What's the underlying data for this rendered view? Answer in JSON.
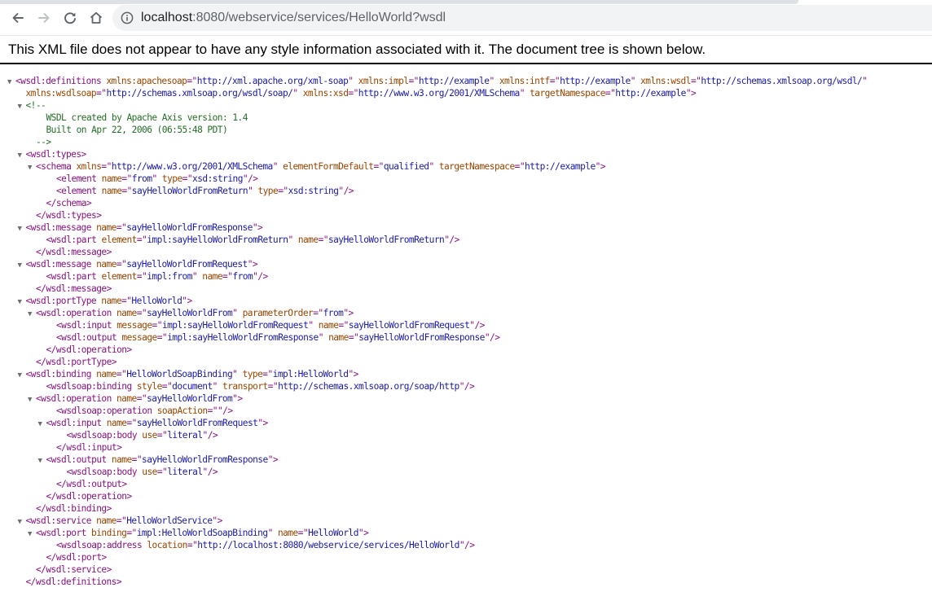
{
  "browser": {
    "url_host": "localhost",
    "url_rest": ":8080/webservice/services/HelloWorld?wsdl"
  },
  "notice": "This XML file does not appear to have any style information associated with it. The document tree is shown below.",
  "colors": {
    "tag": "#881280",
    "attr_name": "#994500",
    "attr_value": "#1a1aa6",
    "comment": "#236e25"
  },
  "lines": [
    {
      "indent": 0,
      "arrow": true,
      "parts": [
        [
          "tg",
          "<wsdl:definitions "
        ],
        [
          "an",
          "xmlns:apachesoap"
        ],
        [
          "tg",
          "=\""
        ],
        [
          "av",
          "http://xml.apache.org/xml-soap"
        ],
        [
          "tg",
          "\" "
        ],
        [
          "an",
          "xmlns:impl"
        ],
        [
          "tg",
          "=\""
        ],
        [
          "av",
          "http://example"
        ],
        [
          "tg",
          "\" "
        ],
        [
          "an",
          "xmlns:intf"
        ],
        [
          "tg",
          "=\""
        ],
        [
          "av",
          "http://example"
        ],
        [
          "tg",
          "\" "
        ],
        [
          "an",
          "xmlns:wsdl"
        ],
        [
          "tg",
          "=\""
        ],
        [
          "av",
          "http://schemas.xmlsoap.org/wsdl/"
        ],
        [
          "tg",
          "\""
        ]
      ]
    },
    {
      "indent": 1,
      "arrow": false,
      "parts": [
        [
          "an",
          "xmlns:wsdlsoap"
        ],
        [
          "tg",
          "=\""
        ],
        [
          "av",
          "http://schemas.xmlsoap.org/wsdl/soap/"
        ],
        [
          "tg",
          "\" "
        ],
        [
          "an",
          "xmlns:xsd"
        ],
        [
          "tg",
          "=\""
        ],
        [
          "av",
          "http://www.w3.org/2001/XMLSchema"
        ],
        [
          "tg",
          "\" "
        ],
        [
          "an",
          "targetNamespace"
        ],
        [
          "tg",
          "=\""
        ],
        [
          "av",
          "http://example"
        ],
        [
          "tg",
          "\">"
        ]
      ]
    },
    {
      "indent": 1,
      "arrow": true,
      "parts": [
        [
          "cm",
          "<!--"
        ]
      ]
    },
    {
      "indent": 3,
      "arrow": false,
      "parts": [
        [
          "cm",
          "WSDL created by Apache Axis version: 1.4"
        ]
      ]
    },
    {
      "indent": 3,
      "arrow": false,
      "parts": [
        [
          "cm",
          "Built on Apr 22, 2006 (06:55:48 PDT)"
        ]
      ]
    },
    {
      "indent": 2,
      "arrow": false,
      "parts": [
        [
          "cm",
          "-->"
        ]
      ]
    },
    {
      "indent": 1,
      "arrow": true,
      "parts": [
        [
          "tg",
          "<wsdl:types>"
        ]
      ]
    },
    {
      "indent": 2,
      "arrow": true,
      "parts": [
        [
          "tg",
          "<schema "
        ],
        [
          "an",
          "xmlns"
        ],
        [
          "tg",
          "=\""
        ],
        [
          "av",
          "http://www.w3.org/2001/XMLSchema"
        ],
        [
          "tg",
          "\" "
        ],
        [
          "an",
          "elementFormDefault"
        ],
        [
          "tg",
          "=\""
        ],
        [
          "av",
          "qualified"
        ],
        [
          "tg",
          "\" "
        ],
        [
          "an",
          "targetNamespace"
        ],
        [
          "tg",
          "=\""
        ],
        [
          "av",
          "http://example"
        ],
        [
          "tg",
          "\">"
        ]
      ]
    },
    {
      "indent": 4,
      "arrow": false,
      "parts": [
        [
          "tg",
          "<element "
        ],
        [
          "an",
          "name"
        ],
        [
          "tg",
          "=\""
        ],
        [
          "av",
          "from"
        ],
        [
          "tg",
          "\" "
        ],
        [
          "an",
          "type"
        ],
        [
          "tg",
          "=\""
        ],
        [
          "av",
          "xsd:string"
        ],
        [
          "tg",
          "\"/>"
        ]
      ]
    },
    {
      "indent": 4,
      "arrow": false,
      "parts": [
        [
          "tg",
          "<element "
        ],
        [
          "an",
          "name"
        ],
        [
          "tg",
          "=\""
        ],
        [
          "av",
          "sayHelloWorldFromReturn"
        ],
        [
          "tg",
          "\" "
        ],
        [
          "an",
          "type"
        ],
        [
          "tg",
          "=\""
        ],
        [
          "av",
          "xsd:string"
        ],
        [
          "tg",
          "\"/>"
        ]
      ]
    },
    {
      "indent": 3,
      "arrow": false,
      "parts": [
        [
          "tg",
          "</schema>"
        ]
      ]
    },
    {
      "indent": 2,
      "arrow": false,
      "parts": [
        [
          "tg",
          "</wsdl:types>"
        ]
      ]
    },
    {
      "indent": 1,
      "arrow": true,
      "parts": [
        [
          "tg",
          "<wsdl:message "
        ],
        [
          "an",
          "name"
        ],
        [
          "tg",
          "=\""
        ],
        [
          "av",
          "sayHelloWorldFromResponse"
        ],
        [
          "tg",
          "\">"
        ]
      ]
    },
    {
      "indent": 3,
      "arrow": false,
      "parts": [
        [
          "tg",
          "<wsdl:part "
        ],
        [
          "an",
          "element"
        ],
        [
          "tg",
          "=\""
        ],
        [
          "av",
          "impl:sayHelloWorldFromReturn"
        ],
        [
          "tg",
          "\" "
        ],
        [
          "an",
          "name"
        ],
        [
          "tg",
          "=\""
        ],
        [
          "av",
          "sayHelloWorldFromReturn"
        ],
        [
          "tg",
          "\"/>"
        ]
      ]
    },
    {
      "indent": 2,
      "arrow": false,
      "parts": [
        [
          "tg",
          "</wsdl:message>"
        ]
      ]
    },
    {
      "indent": 1,
      "arrow": true,
      "parts": [
        [
          "tg",
          "<wsdl:message "
        ],
        [
          "an",
          "name"
        ],
        [
          "tg",
          "=\""
        ],
        [
          "av",
          "sayHelloWorldFromRequest"
        ],
        [
          "tg",
          "\">"
        ]
      ]
    },
    {
      "indent": 3,
      "arrow": false,
      "parts": [
        [
          "tg",
          "<wsdl:part "
        ],
        [
          "an",
          "element"
        ],
        [
          "tg",
          "=\""
        ],
        [
          "av",
          "impl:from"
        ],
        [
          "tg",
          "\" "
        ],
        [
          "an",
          "name"
        ],
        [
          "tg",
          "=\""
        ],
        [
          "av",
          "from"
        ],
        [
          "tg",
          "\"/>"
        ]
      ]
    },
    {
      "indent": 2,
      "arrow": false,
      "parts": [
        [
          "tg",
          "</wsdl:message>"
        ]
      ]
    },
    {
      "indent": 1,
      "arrow": true,
      "parts": [
        [
          "tg",
          "<wsdl:portType "
        ],
        [
          "an",
          "name"
        ],
        [
          "tg",
          "=\""
        ],
        [
          "av",
          "HelloWorld"
        ],
        [
          "tg",
          "\">"
        ]
      ]
    },
    {
      "indent": 2,
      "arrow": true,
      "parts": [
        [
          "tg",
          "<wsdl:operation "
        ],
        [
          "an",
          "name"
        ],
        [
          "tg",
          "=\""
        ],
        [
          "av",
          "sayHelloWorldFrom"
        ],
        [
          "tg",
          "\" "
        ],
        [
          "an",
          "parameterOrder"
        ],
        [
          "tg",
          "=\""
        ],
        [
          "av",
          "from"
        ],
        [
          "tg",
          "\">"
        ]
      ]
    },
    {
      "indent": 4,
      "arrow": false,
      "parts": [
        [
          "tg",
          "<wsdl:input "
        ],
        [
          "an",
          "message"
        ],
        [
          "tg",
          "=\""
        ],
        [
          "av",
          "impl:sayHelloWorldFromRequest"
        ],
        [
          "tg",
          "\" "
        ],
        [
          "an",
          "name"
        ],
        [
          "tg",
          "=\""
        ],
        [
          "av",
          "sayHelloWorldFromRequest"
        ],
        [
          "tg",
          "\"/>"
        ]
      ]
    },
    {
      "indent": 4,
      "arrow": false,
      "parts": [
        [
          "tg",
          "<wsdl:output "
        ],
        [
          "an",
          "message"
        ],
        [
          "tg",
          "=\""
        ],
        [
          "av",
          "impl:sayHelloWorldFromResponse"
        ],
        [
          "tg",
          "\" "
        ],
        [
          "an",
          "name"
        ],
        [
          "tg",
          "=\""
        ],
        [
          "av",
          "sayHelloWorldFromResponse"
        ],
        [
          "tg",
          "\"/>"
        ]
      ]
    },
    {
      "indent": 3,
      "arrow": false,
      "parts": [
        [
          "tg",
          "</wsdl:operation>"
        ]
      ]
    },
    {
      "indent": 2,
      "arrow": false,
      "parts": [
        [
          "tg",
          "</wsdl:portType>"
        ]
      ]
    },
    {
      "indent": 1,
      "arrow": true,
      "parts": [
        [
          "tg",
          "<wsdl:binding "
        ],
        [
          "an",
          "name"
        ],
        [
          "tg",
          "=\""
        ],
        [
          "av",
          "HelloWorldSoapBinding"
        ],
        [
          "tg",
          "\" "
        ],
        [
          "an",
          "type"
        ],
        [
          "tg",
          "=\""
        ],
        [
          "av",
          "impl:HelloWorld"
        ],
        [
          "tg",
          "\">"
        ]
      ]
    },
    {
      "indent": 3,
      "arrow": false,
      "parts": [
        [
          "tg",
          "<wsdlsoap:binding "
        ],
        [
          "an",
          "style"
        ],
        [
          "tg",
          "=\""
        ],
        [
          "av",
          "document"
        ],
        [
          "tg",
          "\" "
        ],
        [
          "an",
          "transport"
        ],
        [
          "tg",
          "=\""
        ],
        [
          "av",
          "http://schemas.xmlsoap.org/soap/http"
        ],
        [
          "tg",
          "\"/>"
        ]
      ]
    },
    {
      "indent": 2,
      "arrow": true,
      "parts": [
        [
          "tg",
          "<wsdl:operation "
        ],
        [
          "an",
          "name"
        ],
        [
          "tg",
          "=\""
        ],
        [
          "av",
          "sayHelloWorldFrom"
        ],
        [
          "tg",
          "\">"
        ]
      ]
    },
    {
      "indent": 4,
      "arrow": false,
      "parts": [
        [
          "tg",
          "<wsdlsoap:operation "
        ],
        [
          "an",
          "soapAction"
        ],
        [
          "tg",
          "=\"\"/>"
        ]
      ]
    },
    {
      "indent": 3,
      "arrow": true,
      "parts": [
        [
          "tg",
          "<wsdl:input "
        ],
        [
          "an",
          "name"
        ],
        [
          "tg",
          "=\""
        ],
        [
          "av",
          "sayHelloWorldFromRequest"
        ],
        [
          "tg",
          "\">"
        ]
      ]
    },
    {
      "indent": 5,
      "arrow": false,
      "parts": [
        [
          "tg",
          "<wsdlsoap:body "
        ],
        [
          "an",
          "use"
        ],
        [
          "tg",
          "=\""
        ],
        [
          "av",
          "literal"
        ],
        [
          "tg",
          "\"/>"
        ]
      ]
    },
    {
      "indent": 4,
      "arrow": false,
      "parts": [
        [
          "tg",
          "</wsdl:input>"
        ]
      ]
    },
    {
      "indent": 3,
      "arrow": true,
      "parts": [
        [
          "tg",
          "<wsdl:output "
        ],
        [
          "an",
          "name"
        ],
        [
          "tg",
          "=\""
        ],
        [
          "av",
          "sayHelloWorldFromResponse"
        ],
        [
          "tg",
          "\">"
        ]
      ]
    },
    {
      "indent": 5,
      "arrow": false,
      "parts": [
        [
          "tg",
          "<wsdlsoap:body "
        ],
        [
          "an",
          "use"
        ],
        [
          "tg",
          "=\""
        ],
        [
          "av",
          "literal"
        ],
        [
          "tg",
          "\"/>"
        ]
      ]
    },
    {
      "indent": 4,
      "arrow": false,
      "parts": [
        [
          "tg",
          "</wsdl:output>"
        ]
      ]
    },
    {
      "indent": 3,
      "arrow": false,
      "parts": [
        [
          "tg",
          "</wsdl:operation>"
        ]
      ]
    },
    {
      "indent": 2,
      "arrow": false,
      "parts": [
        [
          "tg",
          "</wsdl:binding>"
        ]
      ]
    },
    {
      "indent": 1,
      "arrow": true,
      "parts": [
        [
          "tg",
          "<wsdl:service "
        ],
        [
          "an",
          "name"
        ],
        [
          "tg",
          "=\""
        ],
        [
          "av",
          "HelloWorldService"
        ],
        [
          "tg",
          "\">"
        ]
      ]
    },
    {
      "indent": 2,
      "arrow": true,
      "parts": [
        [
          "tg",
          "<wsdl:port "
        ],
        [
          "an",
          "binding"
        ],
        [
          "tg",
          "=\""
        ],
        [
          "av",
          "impl:HelloWorldSoapBinding"
        ],
        [
          "tg",
          "\" "
        ],
        [
          "an",
          "name"
        ],
        [
          "tg",
          "=\""
        ],
        [
          "av",
          "HelloWorld"
        ],
        [
          "tg",
          "\">"
        ]
      ]
    },
    {
      "indent": 4,
      "arrow": false,
      "parts": [
        [
          "tg",
          "<wsdlsoap:address "
        ],
        [
          "an",
          "location"
        ],
        [
          "tg",
          "=\""
        ],
        [
          "av",
          "http://localhost:8080/webservice/services/HelloWorld"
        ],
        [
          "tg",
          "\"/>"
        ]
      ]
    },
    {
      "indent": 3,
      "arrow": false,
      "parts": [
        [
          "tg",
          "</wsdl:port>"
        ]
      ]
    },
    {
      "indent": 2,
      "arrow": false,
      "parts": [
        [
          "tg",
          "</wsdl:service>"
        ]
      ]
    },
    {
      "indent": 1,
      "arrow": false,
      "parts": [
        [
          "tg",
          "</wsdl:definitions>"
        ]
      ]
    }
  ]
}
